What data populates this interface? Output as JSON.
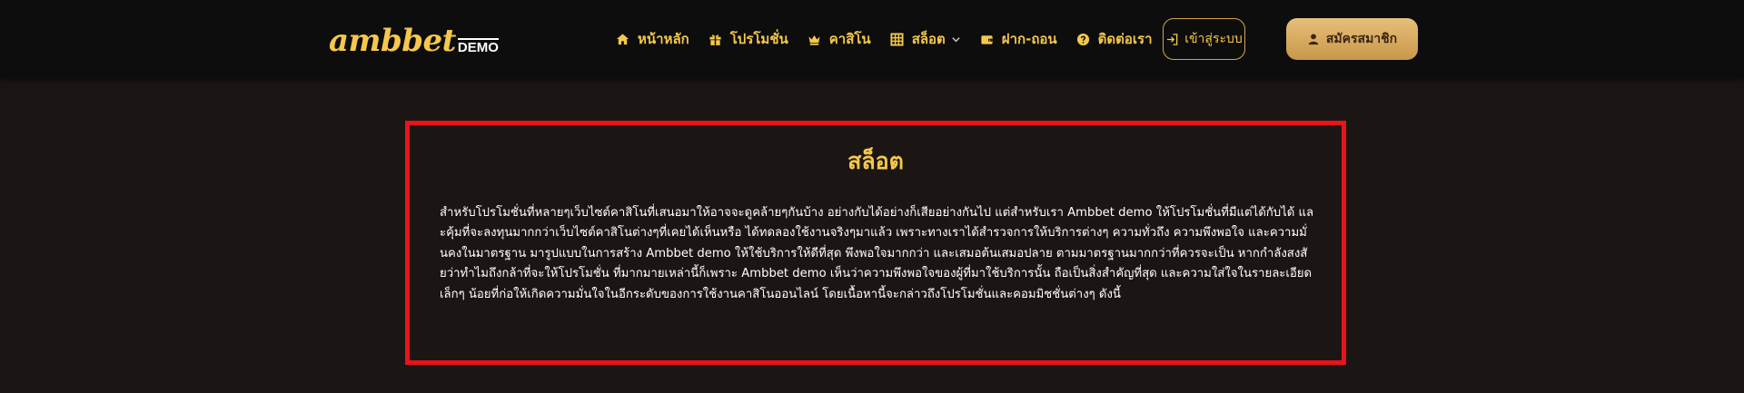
{
  "header": {
    "logo": {
      "main": "ambbet",
      "sub": "DEMO"
    },
    "nav": [
      {
        "label": "หน้าหลัก",
        "icon": "home-icon"
      },
      {
        "label": "โปรโมชั่น",
        "icon": "gift-icon"
      },
      {
        "label": "คาสิโน",
        "icon": "crown-icon"
      },
      {
        "label": "สล็อต",
        "icon": "grid-icon",
        "dropdown": true
      },
      {
        "label": "ฝาก-ถอน",
        "icon": "wallet-icon"
      },
      {
        "label": "ติดต่อเรา",
        "icon": "help-icon"
      }
    ],
    "login_label": "เข้าสู่ระบบ",
    "register_label": "สมัครสมาชิก"
  },
  "content": {
    "title": "สล็อต",
    "body": "สำหรับโปรโมชั่นที่หลายๆเว็บไซต์คาสิโนที่เสนอมาให้อาจจะดูคล้ายๆกันบ้าง อย่างกับได้อย่างก็เสียอย่างกันไป แต่สำหรับเรา Ambbet demo ให้โปรโมชั่นที่มีแต่ได้กับได้ และคุ้มที่จะลงทุนมากกว่าเว็บไซต์คาสิโนต่างๆที่เคยได้เห็นหรือ ได้ทดลองใช้งานจริงๆมาแล้ว เพราะทางเราได้สำรวจการให้บริการต่างๆ ความทั่วถึง ความพึงพอใจ และความมั่นคงในมาตรฐาน มารูปแบบในการสร้าง Ambbet demo ให้ใช้บริการให้ดีที่สุด พึงพอใจมากกว่า และเสมอต้นเสมอปลาย ตามมาตรฐานมากกว่าที่ควรจะเป็น หากกำลังสงสัยว่าทำไมถึงกล้าที่จะให้โปรโมชั่น ที่มากมายเหล่านี้ก็เพราะ Ambbet demo เห็นว่าความพึงพอใจของผู้ที่มาใช้บริการนั้น ถือเป็นสิ่งสำคัญที่สุด และความใส่ใจในรายละเอียดเล็กๆ น้อยที่ก่อให้เกิดความมั่นใจในอีกระดับของการใช้งานคาสิโนออนไลน์ โดยเนื้อหานี้จะกล่าวถึงโปรโมชั่นและคอมมิชชั่นต่างๆ ดังนี้"
  },
  "colors": {
    "gold": "#f5c84c",
    "header_bg": "#0d0d0d",
    "page_bg": "#1b1613",
    "highlight_border": "#e8141a"
  }
}
